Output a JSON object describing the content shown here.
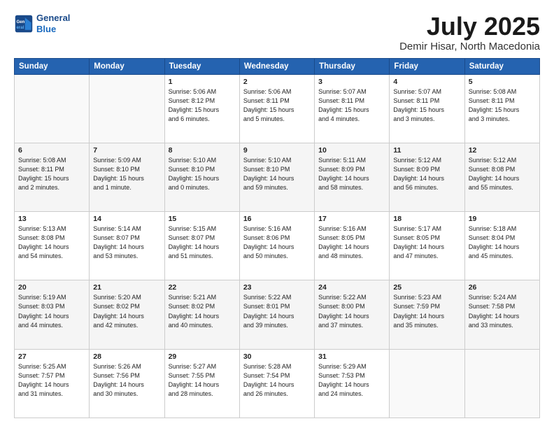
{
  "header": {
    "logo_line1": "General",
    "logo_line2": "Blue",
    "title": "July 2025",
    "location": "Demir Hisar, North Macedonia"
  },
  "weekdays": [
    "Sunday",
    "Monday",
    "Tuesday",
    "Wednesday",
    "Thursday",
    "Friday",
    "Saturday"
  ],
  "rows": [
    [
      {
        "day": "",
        "info": ""
      },
      {
        "day": "",
        "info": ""
      },
      {
        "day": "1",
        "info": "Sunrise: 5:06 AM\nSunset: 8:12 PM\nDaylight: 15 hours\nand 6 minutes."
      },
      {
        "day": "2",
        "info": "Sunrise: 5:06 AM\nSunset: 8:11 PM\nDaylight: 15 hours\nand 5 minutes."
      },
      {
        "day": "3",
        "info": "Sunrise: 5:07 AM\nSunset: 8:11 PM\nDaylight: 15 hours\nand 4 minutes."
      },
      {
        "day": "4",
        "info": "Sunrise: 5:07 AM\nSunset: 8:11 PM\nDaylight: 15 hours\nand 3 minutes."
      },
      {
        "day": "5",
        "info": "Sunrise: 5:08 AM\nSunset: 8:11 PM\nDaylight: 15 hours\nand 3 minutes."
      }
    ],
    [
      {
        "day": "6",
        "info": "Sunrise: 5:08 AM\nSunset: 8:11 PM\nDaylight: 15 hours\nand 2 minutes."
      },
      {
        "day": "7",
        "info": "Sunrise: 5:09 AM\nSunset: 8:10 PM\nDaylight: 15 hours\nand 1 minute."
      },
      {
        "day": "8",
        "info": "Sunrise: 5:10 AM\nSunset: 8:10 PM\nDaylight: 15 hours\nand 0 minutes."
      },
      {
        "day": "9",
        "info": "Sunrise: 5:10 AM\nSunset: 8:10 PM\nDaylight: 14 hours\nand 59 minutes."
      },
      {
        "day": "10",
        "info": "Sunrise: 5:11 AM\nSunset: 8:09 PM\nDaylight: 14 hours\nand 58 minutes."
      },
      {
        "day": "11",
        "info": "Sunrise: 5:12 AM\nSunset: 8:09 PM\nDaylight: 14 hours\nand 56 minutes."
      },
      {
        "day": "12",
        "info": "Sunrise: 5:12 AM\nSunset: 8:08 PM\nDaylight: 14 hours\nand 55 minutes."
      }
    ],
    [
      {
        "day": "13",
        "info": "Sunrise: 5:13 AM\nSunset: 8:08 PM\nDaylight: 14 hours\nand 54 minutes."
      },
      {
        "day": "14",
        "info": "Sunrise: 5:14 AM\nSunset: 8:07 PM\nDaylight: 14 hours\nand 53 minutes."
      },
      {
        "day": "15",
        "info": "Sunrise: 5:15 AM\nSunset: 8:07 PM\nDaylight: 14 hours\nand 51 minutes."
      },
      {
        "day": "16",
        "info": "Sunrise: 5:16 AM\nSunset: 8:06 PM\nDaylight: 14 hours\nand 50 minutes."
      },
      {
        "day": "17",
        "info": "Sunrise: 5:16 AM\nSunset: 8:05 PM\nDaylight: 14 hours\nand 48 minutes."
      },
      {
        "day": "18",
        "info": "Sunrise: 5:17 AM\nSunset: 8:05 PM\nDaylight: 14 hours\nand 47 minutes."
      },
      {
        "day": "19",
        "info": "Sunrise: 5:18 AM\nSunset: 8:04 PM\nDaylight: 14 hours\nand 45 minutes."
      }
    ],
    [
      {
        "day": "20",
        "info": "Sunrise: 5:19 AM\nSunset: 8:03 PM\nDaylight: 14 hours\nand 44 minutes."
      },
      {
        "day": "21",
        "info": "Sunrise: 5:20 AM\nSunset: 8:02 PM\nDaylight: 14 hours\nand 42 minutes."
      },
      {
        "day": "22",
        "info": "Sunrise: 5:21 AM\nSunset: 8:02 PM\nDaylight: 14 hours\nand 40 minutes."
      },
      {
        "day": "23",
        "info": "Sunrise: 5:22 AM\nSunset: 8:01 PM\nDaylight: 14 hours\nand 39 minutes."
      },
      {
        "day": "24",
        "info": "Sunrise: 5:22 AM\nSunset: 8:00 PM\nDaylight: 14 hours\nand 37 minutes."
      },
      {
        "day": "25",
        "info": "Sunrise: 5:23 AM\nSunset: 7:59 PM\nDaylight: 14 hours\nand 35 minutes."
      },
      {
        "day": "26",
        "info": "Sunrise: 5:24 AM\nSunset: 7:58 PM\nDaylight: 14 hours\nand 33 minutes."
      }
    ],
    [
      {
        "day": "27",
        "info": "Sunrise: 5:25 AM\nSunset: 7:57 PM\nDaylight: 14 hours\nand 31 minutes."
      },
      {
        "day": "28",
        "info": "Sunrise: 5:26 AM\nSunset: 7:56 PM\nDaylight: 14 hours\nand 30 minutes."
      },
      {
        "day": "29",
        "info": "Sunrise: 5:27 AM\nSunset: 7:55 PM\nDaylight: 14 hours\nand 28 minutes."
      },
      {
        "day": "30",
        "info": "Sunrise: 5:28 AM\nSunset: 7:54 PM\nDaylight: 14 hours\nand 26 minutes."
      },
      {
        "day": "31",
        "info": "Sunrise: 5:29 AM\nSunset: 7:53 PM\nDaylight: 14 hours\nand 24 minutes."
      },
      {
        "day": "",
        "info": ""
      },
      {
        "day": "",
        "info": ""
      }
    ]
  ]
}
